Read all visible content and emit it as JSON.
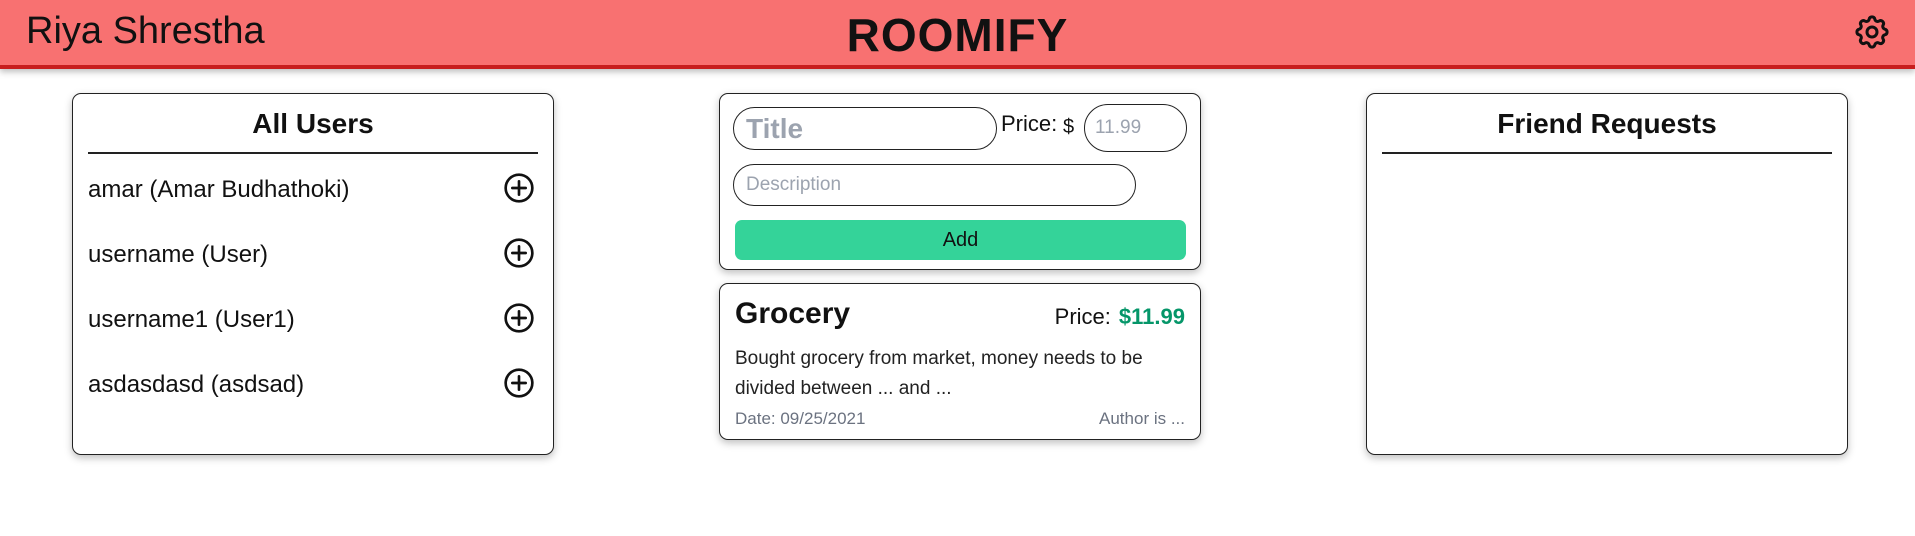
{
  "header": {
    "user_name": "Riya Shrestha",
    "app_title": "ROOMIFY",
    "settings_icon": "gear-icon",
    "background": "#f87171",
    "border_color": "#c81e1e"
  },
  "all_users": {
    "heading": "All Users",
    "add_icon": "plus-circle-icon",
    "users": [
      {
        "label": "amar (Amar Budhathoki)"
      },
      {
        "label": "username (User)"
      },
      {
        "label": "username1 (User1)"
      },
      {
        "label": "asdasdasd (asdsad)"
      }
    ]
  },
  "expense_form": {
    "title_value": "",
    "title_placeholder": "Title",
    "price_label": "Price:",
    "currency_symbol": "$",
    "price_value": "",
    "price_placeholder": "11.99",
    "description_value": "",
    "description_placeholder": "Description",
    "add_label": "Add",
    "add_color": "#34d399"
  },
  "expenses": [
    {
      "title": "Grocery",
      "price_label": "Price:",
      "price_value": "$11.99",
      "price_color": "#059669",
      "description": "Bought grocery from market, money needs to be divided between ... and ...",
      "date": "Date: 09/25/2021",
      "author": "Author is ..."
    }
  ],
  "friend_requests": {
    "heading": "Friend Requests",
    "items": []
  }
}
